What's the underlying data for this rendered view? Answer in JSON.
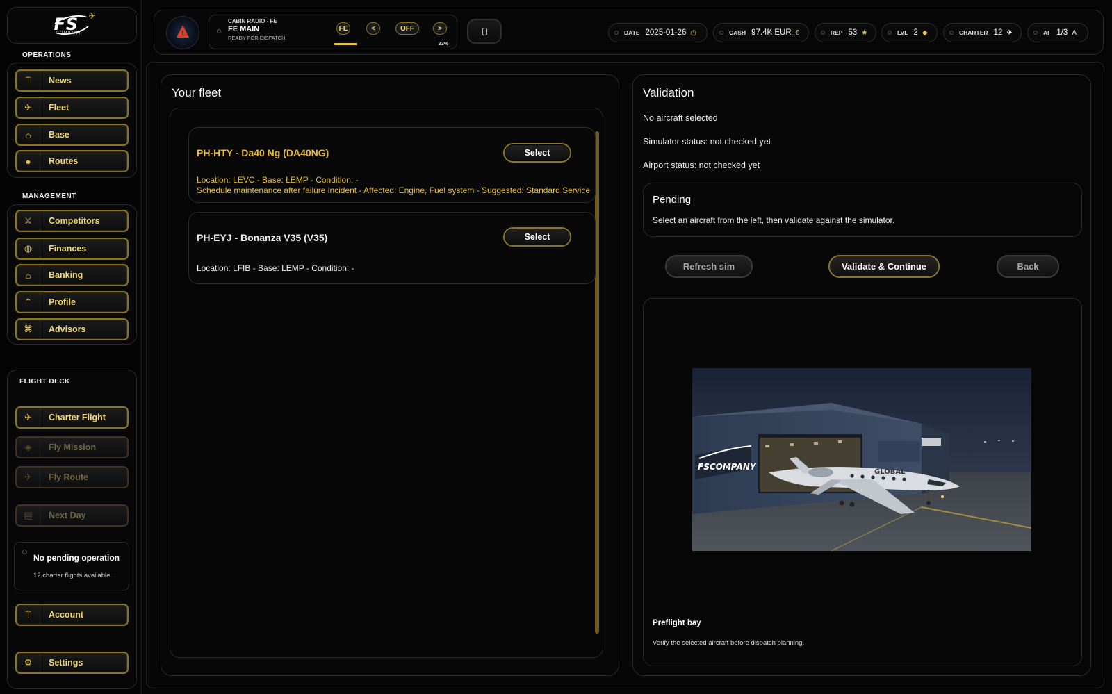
{
  "brand": {
    "logo_text": "FS",
    "logo_sub": "COMPANY"
  },
  "sidebar": {
    "operations_title": "OPERATIONS",
    "management_title": "MANAGEMENT",
    "flight_deck_title": "FLIGHT DECK",
    "operations": [
      {
        "label": "News",
        "icon": "news-icon"
      },
      {
        "label": "Fleet",
        "icon": "plane-icon"
      },
      {
        "label": "Base",
        "icon": "hangar-icon"
      },
      {
        "label": "Routes",
        "icon": "globe-icon"
      }
    ],
    "management": [
      {
        "label": "Competitors",
        "icon": "versus-icon"
      },
      {
        "label": "Finances",
        "icon": "coins-icon"
      },
      {
        "label": "Banking",
        "icon": "bank-icon"
      },
      {
        "label": "Profile",
        "icon": "wings-icon"
      },
      {
        "label": "Advisors",
        "icon": "advisor-icon"
      }
    ],
    "flight_deck": [
      {
        "label": "Charter Flight",
        "icon": "plane-icon",
        "enabled": true
      },
      {
        "label": "Fly Mission",
        "icon": "target-icon",
        "enabled": false
      },
      {
        "label": "Fly Route",
        "icon": "plane-icon",
        "enabled": false
      },
      {
        "label": "Next Day",
        "icon": "calendar-icon",
        "enabled": false
      }
    ],
    "pending": {
      "title": "No pending operation",
      "subtitle": "12 charter flights available."
    },
    "account_label": "Account",
    "settings_label": "Settings"
  },
  "topbar": {
    "radio": {
      "title": "CABIN RADIO - FE",
      "station": "FE MAIN",
      "status": "READY FOR DISPATCH",
      "btn_fe": "FE",
      "btn_prev": "<",
      "btn_off": "OFF",
      "btn_next": ">",
      "volume_pct": "32%"
    },
    "stats": [
      {
        "key": "DATE",
        "value": "2025-01-26",
        "icon": "◷"
      },
      {
        "key": "CASH",
        "value": "97.4K EUR",
        "icon": "€"
      },
      {
        "key": "REP",
        "value": "53",
        "icon": "★"
      },
      {
        "key": "LVL",
        "value": "2",
        "icon": "◆"
      },
      {
        "key": "CHARTER",
        "value": "12",
        "icon": "✈"
      },
      {
        "key": "AF",
        "value": "1/3",
        "icon": "A"
      }
    ]
  },
  "fleet": {
    "title": "Your fleet",
    "items": [
      {
        "name": "PH-HTY - Da40 Ng (DA40NG)",
        "meta": "Location: LEVC   -   Base: LEMP   -   Condition:  -",
        "warning": "Schedule maintenance after failure incident - Affected: Engine, Fuel system - Suggested: Standard Service",
        "select_label": "Select"
      },
      {
        "name": "PH-EYJ - Bonanza V35 (V35)",
        "meta": "Location: LFIB   -   Base: LEMP   -   Condition:  -",
        "select_label": "Select"
      }
    ]
  },
  "validation": {
    "title": "Validation",
    "aircraft_status": "No aircraft selected",
    "simulator_status": "Simulator status: not checked yet",
    "airport_status": "Airport status: not checked yet",
    "pending_title": "Pending",
    "pending_text": "Select an aircraft from the left, then validate against the simulator.",
    "refresh_label": "Refresh sim",
    "validate_label": "Validate & Continue",
    "back_label": "Back",
    "preview_title": "Preflight bay",
    "preview_text": "Verify the selected aircraft before dispatch planning.",
    "hangar_logo_text": "FSCOMPANY",
    "jet_livery_text": "GLOBAL"
  },
  "colors": {
    "accent": "#e6c44a",
    "warning": "#e7bc3b",
    "border_gold": "#8a7228"
  }
}
